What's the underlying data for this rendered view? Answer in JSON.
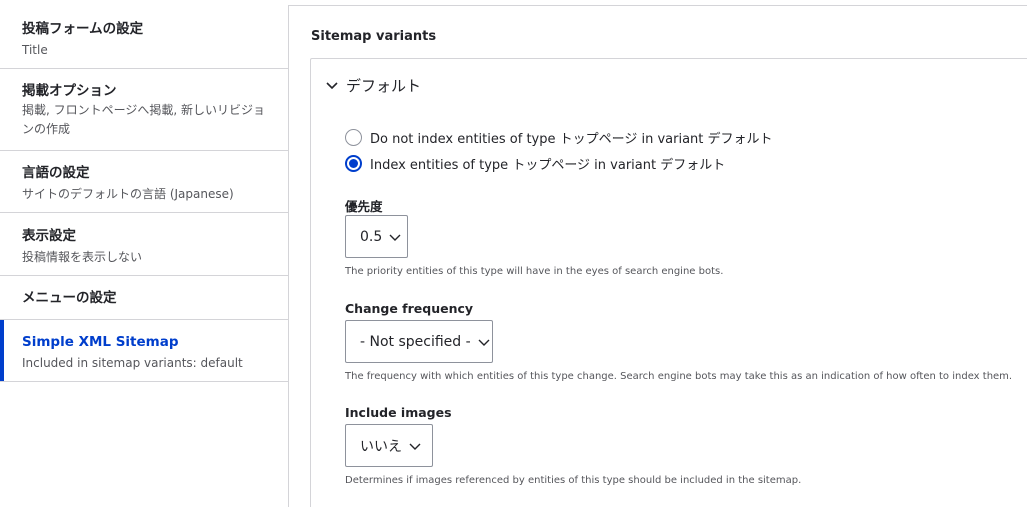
{
  "sidebar": {
    "tabs": [
      {
        "title": "投稿フォームの設定",
        "summary": "Title"
      },
      {
        "title": "掲載オプション",
        "summary_line1": "掲載, フロントページへ掲載, 新しいリビジョ",
        "summary_line2": "ンの作成"
      },
      {
        "title": "言語の設定",
        "summary": "サイトのデフォルトの言語 (Japanese)"
      },
      {
        "title": "表示設定",
        "summary": "投稿情報を表示しない"
      },
      {
        "title": "メニューの設定"
      },
      {
        "title": "Simple XML Sitemap",
        "summary": "Included in sitemap variants: default"
      }
    ]
  },
  "main": {
    "legend": "Sitemap variants",
    "variant": {
      "label": "デフォルト",
      "radio_options": [
        {
          "label": "Do not index entities of type トップページ in variant デフォルト",
          "checked": false
        },
        {
          "label": "Index entities of type トップページ in variant デフォルト",
          "checked": true
        }
      ],
      "priority": {
        "label": "優先度",
        "value": "0.5",
        "description": "The priority entities of this type will have in the eyes of search engine bots."
      },
      "changefreq": {
        "label": "Change frequency",
        "value": "- Not specified -",
        "description": "The frequency with which entities of this type change. Search engine bots may take this as an indication of how often to index them."
      },
      "images": {
        "label": "Include images",
        "value": "いいえ",
        "description": "Determines if images referenced by entities of this type should be included in the sitemap."
      }
    }
  },
  "colors": {
    "accent": "#003ecc",
    "border": "#d4d4d8",
    "text": "#232429",
    "muted": "#55565b"
  },
  "icons": [
    "chevron-down-icon",
    "select-caret-icon"
  ]
}
